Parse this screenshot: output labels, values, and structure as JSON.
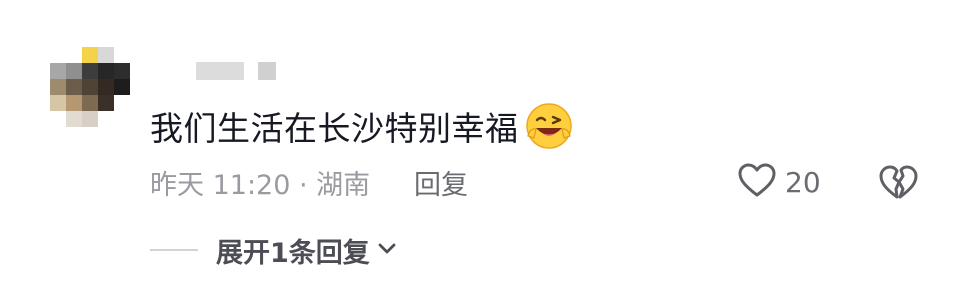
{
  "comment": {
    "text": "我们生活在长沙特别幸福",
    "emoji": "grinning-wink-emoji"
  },
  "meta": {
    "time_location": "昨天 11:20 · 湖南",
    "reply_label": "回复"
  },
  "actions": {
    "like_count": "20",
    "like_icon": "heart-outline-icon",
    "dislike_icon": "broken-heart-icon"
  },
  "replies": {
    "expand_label": "展开1条回复"
  },
  "colors": {
    "text_primary": "#161823",
    "text_secondary": "#9a9ba1",
    "text_action": "#6b6c72"
  }
}
